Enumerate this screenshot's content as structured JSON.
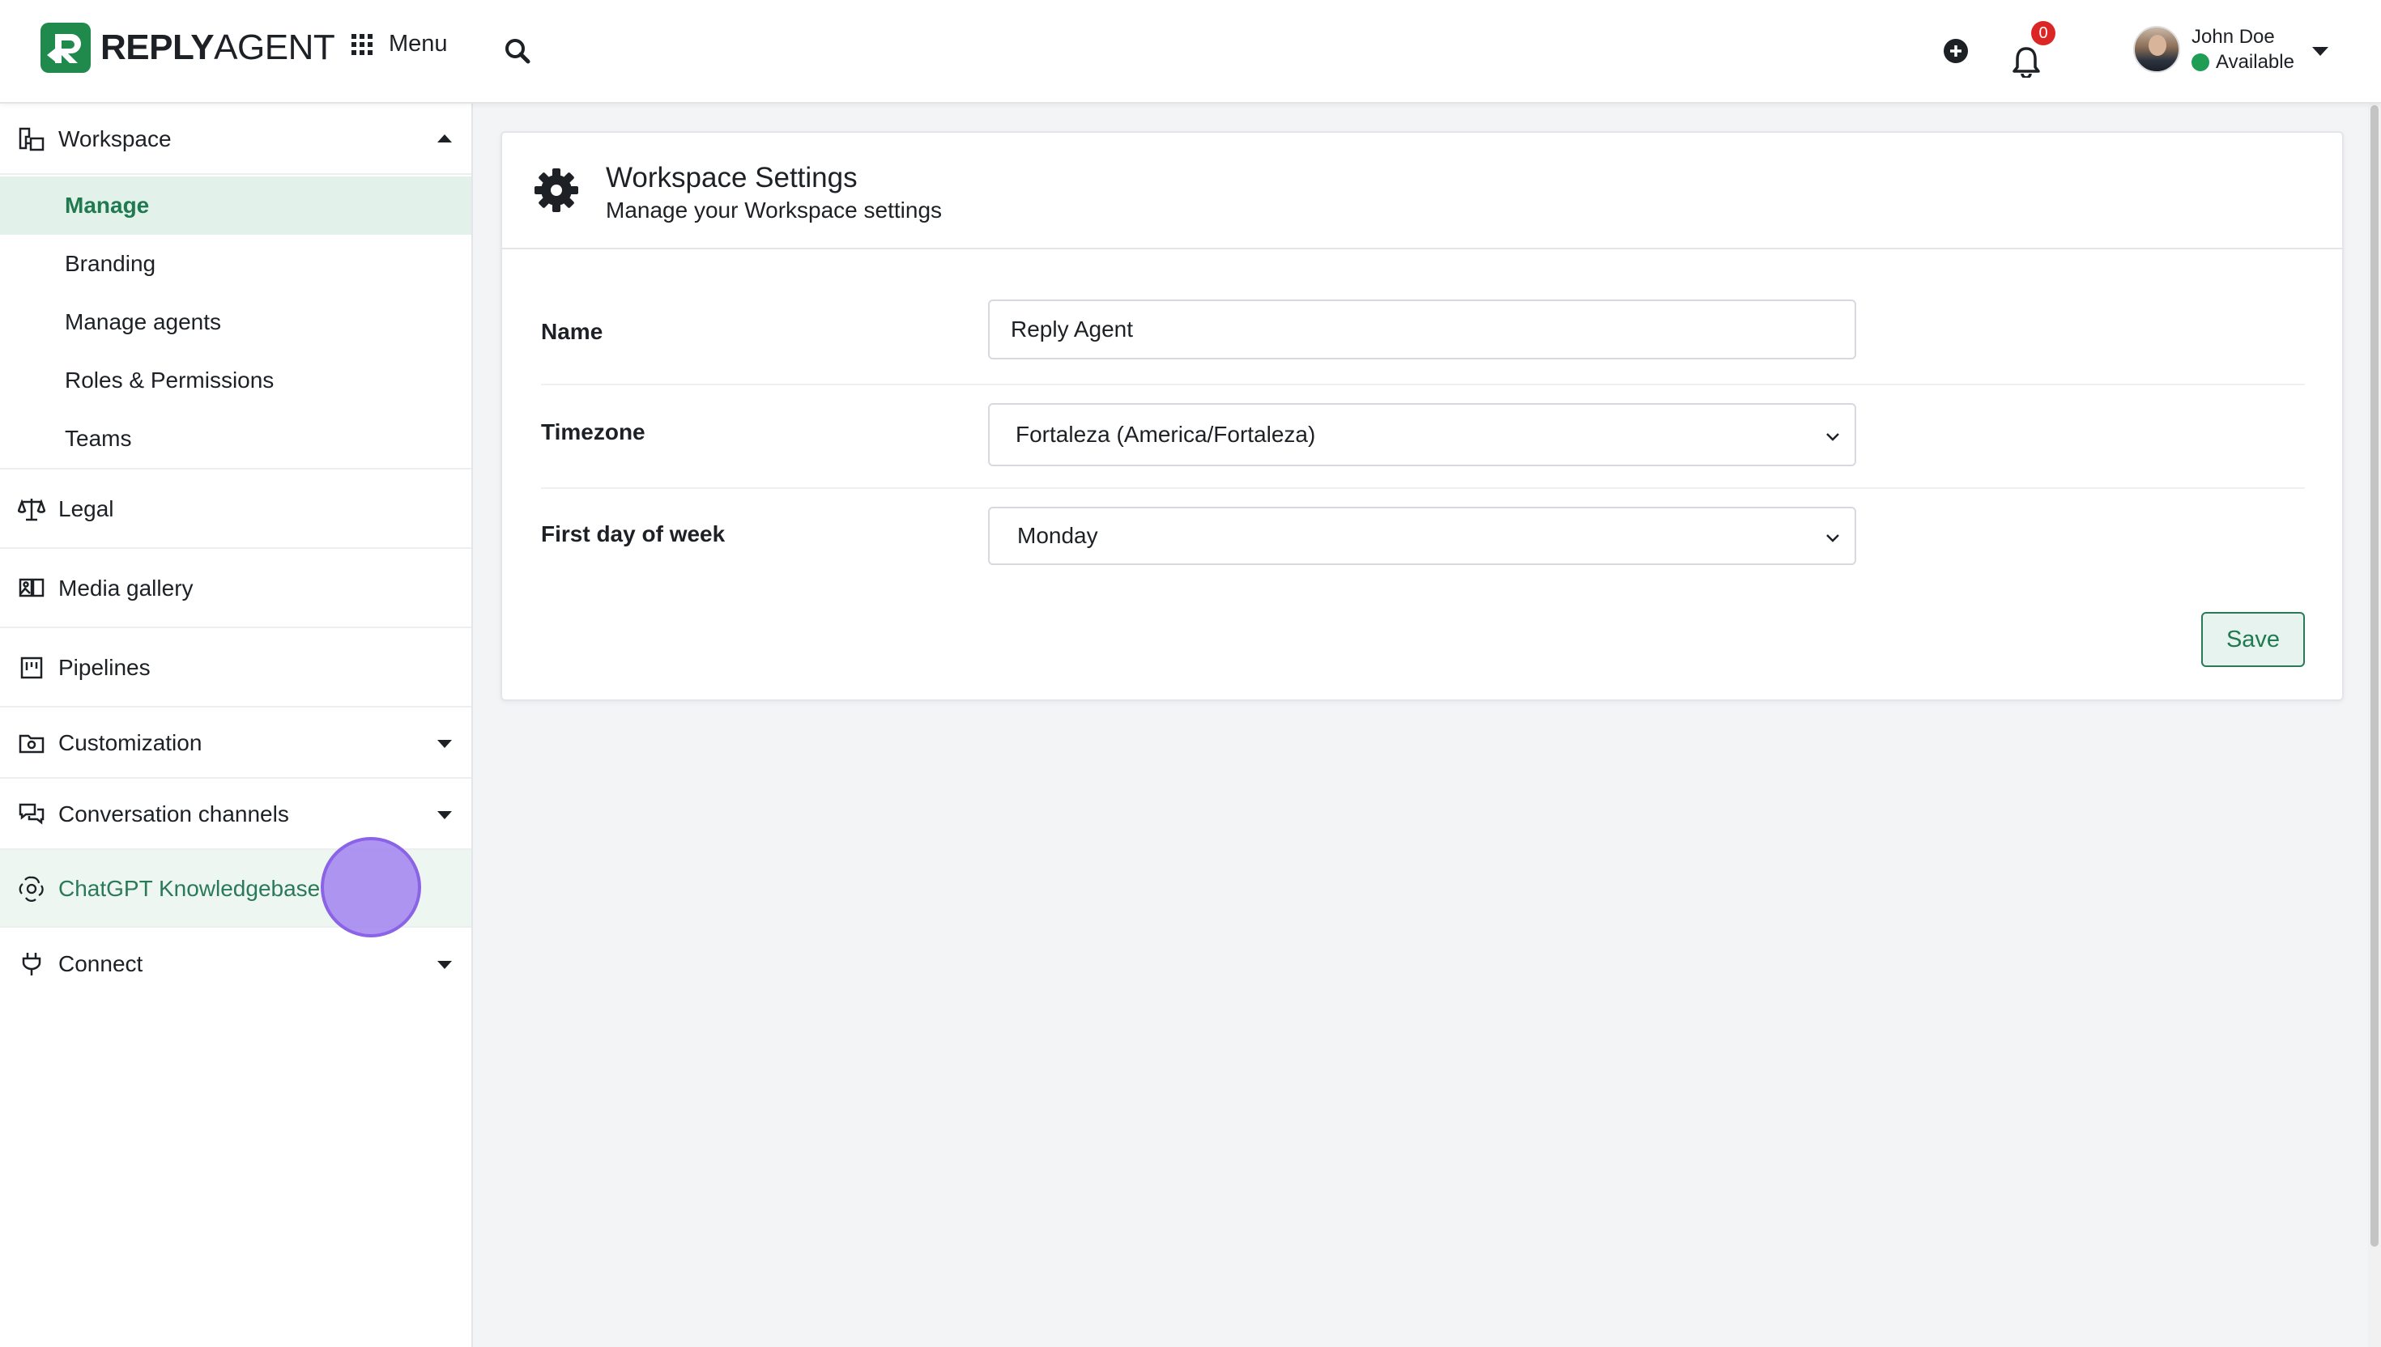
{
  "header": {
    "logo_bold": "REPLY",
    "logo_light": "AGENT",
    "menu_label": "Menu",
    "notification_count": "0",
    "user_name": "John Doe",
    "user_status": "Available"
  },
  "sidebar": {
    "workspace": {
      "label": "Workspace",
      "items": [
        {
          "label": "Manage",
          "active": true
        },
        {
          "label": "Branding"
        },
        {
          "label": "Manage agents"
        },
        {
          "label": "Roles & Permissions"
        },
        {
          "label": "Teams"
        }
      ]
    },
    "groups": [
      {
        "label": "Legal",
        "icon": "scale-icon"
      },
      {
        "label": "Media gallery",
        "icon": "gallery-icon"
      },
      {
        "label": "Pipelines",
        "icon": "pipeline-icon"
      },
      {
        "label": "Customization",
        "icon": "folder-gear-icon"
      },
      {
        "label": "Conversation channels",
        "icon": "chat-icon"
      },
      {
        "label": "ChatGPT Knowledgebase",
        "icon": "openai-icon"
      },
      {
        "label": "Connect",
        "icon": "plug-icon"
      }
    ]
  },
  "card": {
    "title": "Workspace Settings",
    "subtitle": "Manage your Workspace settings",
    "fields": {
      "name": {
        "label": "Name",
        "value": "Reply Agent"
      },
      "timezone": {
        "label": "Timezone",
        "value": "Fortaleza (America/Fortaleza)"
      },
      "first_day": {
        "label": "First day of week",
        "value": "Monday"
      }
    },
    "save_label": "Save"
  },
  "colors": {
    "brand_green": "#1f8a4c",
    "active_bg": "#e3f1eb",
    "badge_red": "#dc2626"
  }
}
